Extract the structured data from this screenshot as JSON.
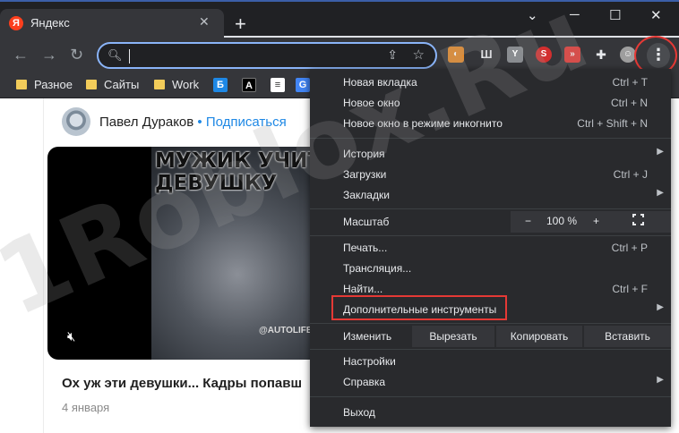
{
  "tab": {
    "favicon": "Я",
    "title": "Яндекс",
    "close": "✕",
    "new_tab": "+"
  },
  "window": {
    "minimize": "⌄",
    "restore": "─",
    "maximize": "☐",
    "close": "✕"
  },
  "toolbar": {
    "back": "←",
    "forward": "→",
    "reload": "↻",
    "address_value": "",
    "menu_icon": "⋮"
  },
  "bookmarks": [
    {
      "label": "Разное"
    },
    {
      "label": "Сайты"
    },
    {
      "label": "Work"
    }
  ],
  "post": {
    "author": "Павел Дураков",
    "separator": " • ",
    "subscribe": "Подписаться",
    "video_caption": "МУЖИК УЧИТ ДЕВУШКУ",
    "video_watermark": "@AUTOLIFE_KZ",
    "title": "Ох уж эти девушки... Кадры попавш",
    "date": "4 января"
  },
  "watermark_text": "1Roblox.Ru",
  "menu": {
    "new_tab": {
      "label": "Новая вкладка",
      "shortcut": "Ctrl + T"
    },
    "new_window": {
      "label": "Новое окно",
      "shortcut": "Ctrl + N"
    },
    "incognito": {
      "label": "Новое окно в режиме инкогнито",
      "shortcut": "Ctrl + Shift + N"
    },
    "history": {
      "label": "История"
    },
    "downloads": {
      "label": "Загрузки",
      "shortcut": "Ctrl + J"
    },
    "bookmarks": {
      "label": "Закладки"
    },
    "zoom": {
      "label": "Масштаб",
      "minus": "−",
      "value": "100 %",
      "plus": "+"
    },
    "print": {
      "label": "Печать...",
      "shortcut": "Ctrl + P"
    },
    "cast": {
      "label": "Трансляция..."
    },
    "find": {
      "label": "Найти...",
      "shortcut": "Ctrl + F"
    },
    "more_tools": {
      "label": "Дополнительные инструменты"
    },
    "edit": {
      "label": "Изменить",
      "cut": "Вырезать",
      "copy": "Копировать",
      "paste": "Вставить"
    },
    "settings": {
      "label": "Настройки"
    },
    "help": {
      "label": "Справка"
    },
    "exit": {
      "label": "Выход"
    }
  },
  "colors": {
    "accent": "#8ab4f8",
    "highlight": "#e53935",
    "menu_bg": "#292a2d"
  }
}
